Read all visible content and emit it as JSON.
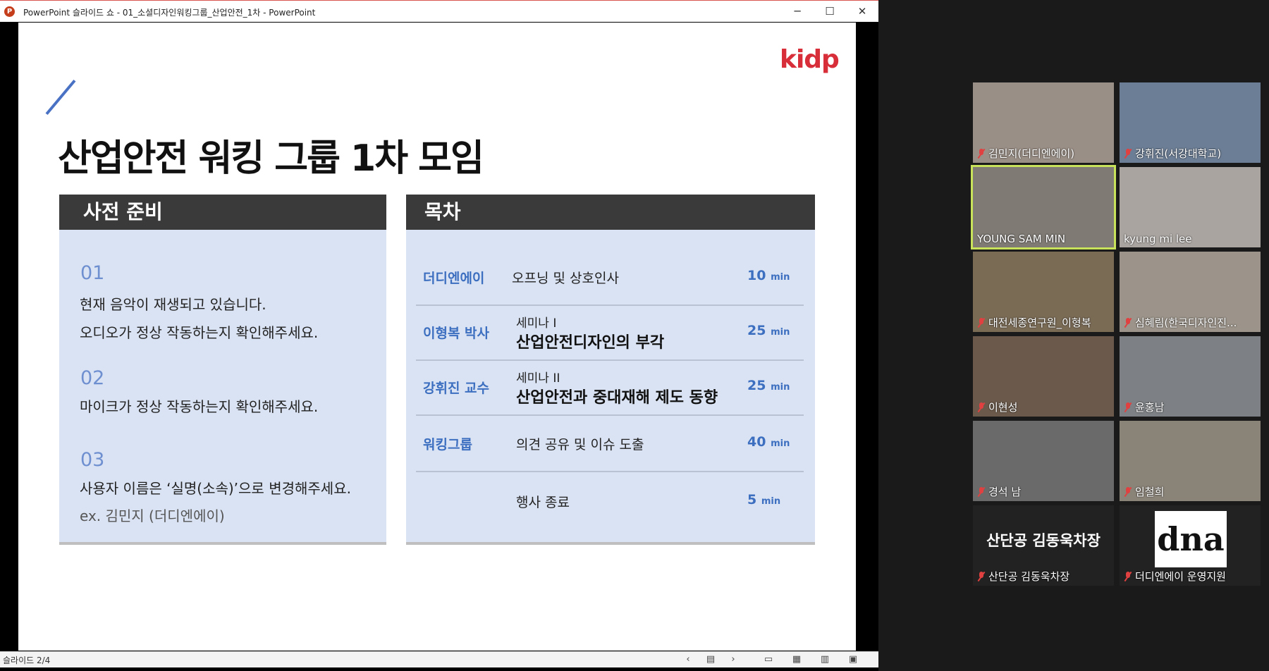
{
  "window": {
    "app_icon_letter": "P",
    "title": "PowerPoint 슬라이드 쇼  -  01_소셜디자인워킹그룹_산업안전_1차 - PowerPoint",
    "minimize": "─",
    "maximize": "☐",
    "close": "✕"
  },
  "slide": {
    "logo": "kidp",
    "title": "산업안전 워킹 그룹 1차 모임",
    "prep": {
      "heading": "사전 준비",
      "steps": [
        {
          "num": "01",
          "lines": [
            "현재 음악이 재생되고 있습니다.",
            "오디오가 정상 작동하는지 확인해주세요."
          ]
        },
        {
          "num": "02",
          "lines": [
            "마이크가 정상 작동하는지 확인해주세요."
          ]
        },
        {
          "num": "03",
          "lines": [
            "사용자 이름은 ‘실명(소속)’으로 변경해주세요.",
            "ex. 김민지 (더디엔에이)"
          ]
        }
      ]
    },
    "toc": {
      "heading": "목차",
      "rows": [
        {
          "who": "더디엔에이",
          "single": "오프닝 및 상호인사",
          "time": "10",
          "unit": "min"
        },
        {
          "who": "이형복 박사",
          "sub": "세미나 I",
          "main": "산업안전디자인의 부각",
          "time": "25",
          "unit": "min"
        },
        {
          "who": "강휘진 교수",
          "sub": "세미나 II",
          "main": "산업안전과 중대재해 제도 동향",
          "time": "25",
          "unit": "min"
        },
        {
          "who": "워킹그룹",
          "single": "의견 공유 및 이슈 도출",
          "time": "40",
          "unit": "min"
        },
        {
          "who": "",
          "single": "행사 종료",
          "time": "5",
          "unit": "min"
        }
      ]
    }
  },
  "statusbar": {
    "slide_counter": "슬라이드 2/4",
    "prev": "‹",
    "notes": "▤",
    "next": "›",
    "view_normal": "▭",
    "view_sorter": "▦",
    "view_reading": "▥",
    "view_show": "▣"
  },
  "participants": [
    {
      "name": "김민지(더디엔에이)",
      "muted": true,
      "bg": "#9a8f86"
    },
    {
      "name": "강휘진(서강대학교)",
      "muted": true,
      "bg": "#6c7e95"
    },
    {
      "name": "YOUNG SAM MIN",
      "muted": false,
      "bg": "#7f7a74",
      "active": true
    },
    {
      "name": "kyung mi lee",
      "muted": false,
      "bg": "#a9a4a0"
    },
    {
      "name": "대전세종연구원_이형복",
      "muted": true,
      "bg": "#7a6b55"
    },
    {
      "name": "심혜림(한국디자인진...",
      "muted": true,
      "bg": "#9c948a"
    },
    {
      "name": "이현성",
      "muted": true,
      "bg": "#6b5a4b"
    },
    {
      "name": "윤홍남",
      "muted": true,
      "bg": "#7d8084"
    },
    {
      "name": "경석 남",
      "muted": true,
      "bg": "#6a6a6a"
    },
    {
      "name": "임철희",
      "muted": true,
      "bg": "#8a8378"
    },
    {
      "name": "산단공 김동욱차장",
      "muted": true,
      "bg": "#222222",
      "big_text": "산단공 김동욱차장"
    },
    {
      "name": "더디엔에이 운영지원",
      "muted": true,
      "bg": "#222222",
      "logo_text": "dna"
    }
  ]
}
